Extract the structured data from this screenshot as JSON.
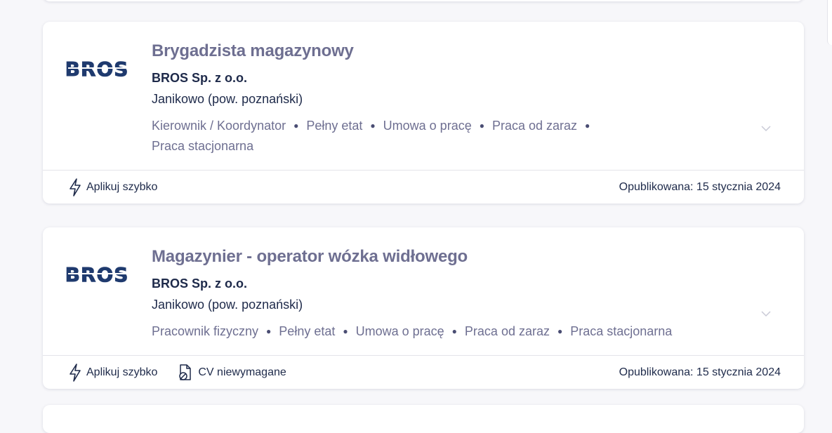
{
  "listings": [
    {
      "title": "Brygadzista magazynowy",
      "company": "BROS Sp. z o.o.",
      "location": "Janikowo (pow. poznański)",
      "tags": [
        "Kierownik / Koordynator",
        "Pełny etat",
        "Umowa o pracę",
        "Praca od zaraz",
        "Praca stacjonarna"
      ],
      "logo_text": "BROS",
      "quick_apply": "Aplikuj szybko",
      "cv_note": "",
      "published": "Opublikowana: 15 stycznia 2024"
    },
    {
      "title": "Magazynier - operator wózka widłowego",
      "company": "BROS Sp. z o.o.",
      "location": "Janikowo (pow. poznański)",
      "tags": [
        "Pracownik fizyczny",
        "Pełny etat",
        "Umowa o pracę",
        "Praca od zaraz",
        "Praca stacjonarna"
      ],
      "logo_text": "BROS",
      "quick_apply": "Aplikuj szybko",
      "cv_note": "CV niewymagane",
      "published": "Opublikowana: 15 stycznia 2024"
    }
  ],
  "colors": {
    "title": "#6e6f91",
    "text": "#1e2a4a",
    "logo_fill": "#1f3a6e",
    "background": "#f7f7fa"
  },
  "icons": {
    "quick_apply": "lightning-icon",
    "cv": "document-off-icon",
    "expand": "chevron-down-icon"
  }
}
